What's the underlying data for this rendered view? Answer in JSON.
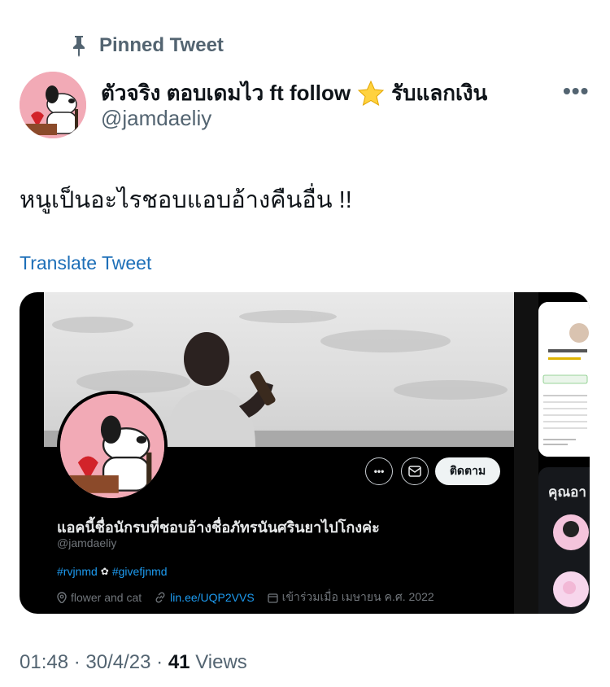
{
  "pinned": {
    "label": "Pinned Tweet",
    "icon": "pin-icon"
  },
  "author": {
    "display_name": "ตัวจริง ตอบเดมไว ft follow",
    "display_name_suffix": "รับแลกเงิน",
    "handle": "@jamdaeliy",
    "star_icon": "star-emoji"
  },
  "menu": {
    "more_label": "•••"
  },
  "tweet": {
    "text": "หนูเป็นอะไรชอบแอบอ้างคืนอื่น !!",
    "translate_label": "Translate Tweet"
  },
  "embedded_profile": {
    "name": "แอคนี้ชื่อนักรบที่ชอบอ้างชื่อภัทรนันศรินยาไปโกงค่ะ",
    "handle": "@jamdaeliy",
    "tags": [
      "#rvjnmd",
      "#givefjnmd"
    ],
    "tag_separator": "✿",
    "location": "flower and cat",
    "link": "lin.ee/UQP2VVS",
    "joined": "เข้าร่วมเมื่อ เมษายน ค.ศ. 2022",
    "follow_button": "ติดตาม",
    "more_button": "•••",
    "side_title": "คุณอา"
  },
  "footer": {
    "time": "01:48",
    "date": "30/4/23",
    "sep": "·",
    "views_count": "41",
    "views_label": "Views"
  },
  "colors": {
    "link": "#1d9bf0",
    "muted": "#536471",
    "text": "#0f1419"
  }
}
